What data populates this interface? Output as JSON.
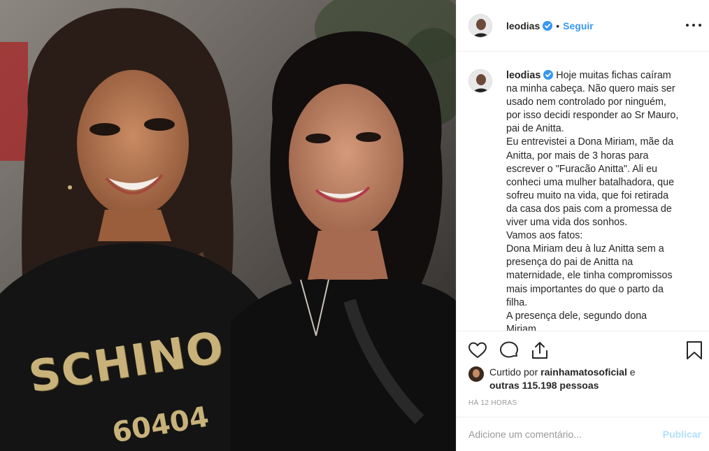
{
  "post": {
    "username": "leodias",
    "follow_label": "Seguir",
    "separator": "•",
    "photo_shirt_text": "SCHINO",
    "photo_shirt_number": "60404",
    "caption_lines": [
      "Hoje muitas fichas caíram",
      "na minha cabeça. Não quero mais ser",
      "usado nem controlado por ninguém,",
      "por isso decidi responder ao Sr Mauro,",
      "pai de Anitta.",
      "Eu entrevistei a Dona Miriam, mãe da",
      "Anitta, por mais de 3 horas para",
      "escrever o \"Furacão Anitta\". Ali eu",
      "conheci uma mulher batalhadora, que",
      "sofreu muito na vida, que foi retirada",
      "da casa dos pais com a promessa de",
      "viver uma vida dos sonhos.",
      "Vamos aos fatos:",
      "Dona Miriam deu à luz Anitta sem a",
      "presença do pai de Anitta na",
      "maternidade, ele tinha compromissos",
      "mais importantes do que o parto da",
      "filha.",
      "A presença dele, segundo dona",
      "Miriam, ..."
    ],
    "likes": {
      "prefix": "Curtido por",
      "liker": "rainhamatosoficial",
      "conjunction": "e",
      "others": "outras 115.198 pessoas"
    },
    "time_ago": "HÁ 12 HORAS",
    "comment": {
      "placeholder": "Adicione um comentário...",
      "value": "",
      "publish_label": "Publicar"
    }
  },
  "colors": {
    "accent": "#3897f0",
    "verified": "#3897f0",
    "publish_disabled": "#b2dffc",
    "muted": "#999999",
    "text": "#262626"
  },
  "icons": [
    "verified-badge-icon",
    "more-options-icon",
    "heart-icon",
    "comment-icon",
    "share-icon",
    "bookmark-icon"
  ]
}
